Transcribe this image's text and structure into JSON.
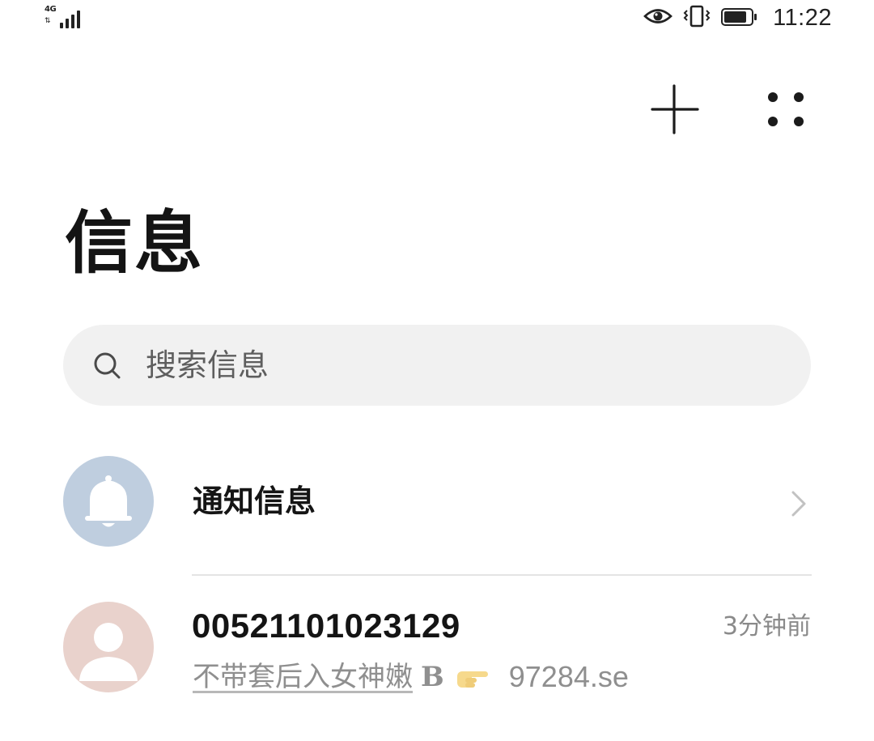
{
  "status_bar": {
    "network": "4G",
    "time": "11:22",
    "icons": [
      "signal-icon",
      "eye-comfort-icon",
      "vibrate-icon",
      "battery-icon"
    ],
    "battery_level": 0.85
  },
  "toolbar": {
    "add_icon": "plus-icon",
    "more_icon": "more-dots-icon"
  },
  "header": {
    "title": "信息"
  },
  "search": {
    "placeholder": "搜索信息",
    "icon": "search-icon"
  },
  "notification_row": {
    "title": "通知信息",
    "avatar_icon": "bell-icon",
    "avatar_color": "#bfcedf",
    "chevron_icon": "chevron-right-icon"
  },
  "conversations": [
    {
      "sender": "00521101023129",
      "time": "3分钟前",
      "preview_text": "不带套后入女神嫩",
      "preview_b": "B",
      "preview_emoji": "pointing-hand-icon",
      "preview_link": "97284.se",
      "avatar_icon": "person-icon",
      "avatar_color": "#e9d2cc"
    }
  ]
}
